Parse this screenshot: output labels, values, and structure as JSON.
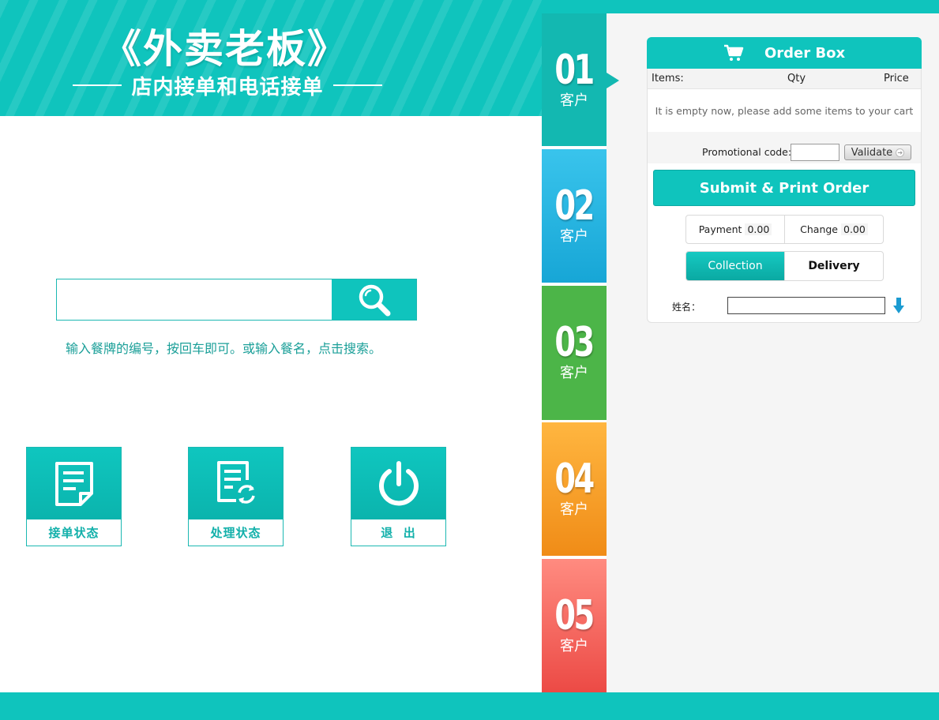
{
  "header": {
    "title": "《外卖老板》",
    "subtitle": "店内接单和电话接单"
  },
  "search": {
    "placeholder": "",
    "hint": "输入餐牌的编号，按回车即可。或输入餐名，点击搜索。",
    "button_icon": "search-icon"
  },
  "tiles": [
    {
      "label": "接单状态",
      "icon": "document-icon"
    },
    {
      "label": "处理状态",
      "icon": "document-refresh-icon"
    },
    {
      "label": "退  出",
      "icon": "power-icon"
    }
  ],
  "customers": [
    {
      "number": "01",
      "label": "客户",
      "color": "#13b8b1"
    },
    {
      "number": "02",
      "label": "客户",
      "color": "#17a6d6"
    },
    {
      "number": "03",
      "label": "客户",
      "color": "#4cb548"
    },
    {
      "number": "04",
      "label": "客户",
      "color": "#f08c17"
    },
    {
      "number": "05",
      "label": "客户",
      "color": "#ec4a45"
    }
  ],
  "order_box": {
    "title": "Order Box",
    "icon": "cart-icon",
    "columns": {
      "items": "Items:",
      "qty": "Qty",
      "price": "Price"
    },
    "empty_message": "It is empty now, please add some items to your cart",
    "promo_label": "Promotional code:",
    "promo_value": "",
    "validate_label": "Validate",
    "submit_label": "Submit & Print Order",
    "payment_label": "Payment",
    "payment_value": "0.00",
    "change_label": "Change",
    "change_value": "0.00",
    "collection_label": "Collection",
    "delivery_label": "Delivery",
    "name_label": "姓名：",
    "name_value": ""
  },
  "colors": {
    "accent": "#0fc4bd",
    "hint_text": "#1a9f98"
  }
}
